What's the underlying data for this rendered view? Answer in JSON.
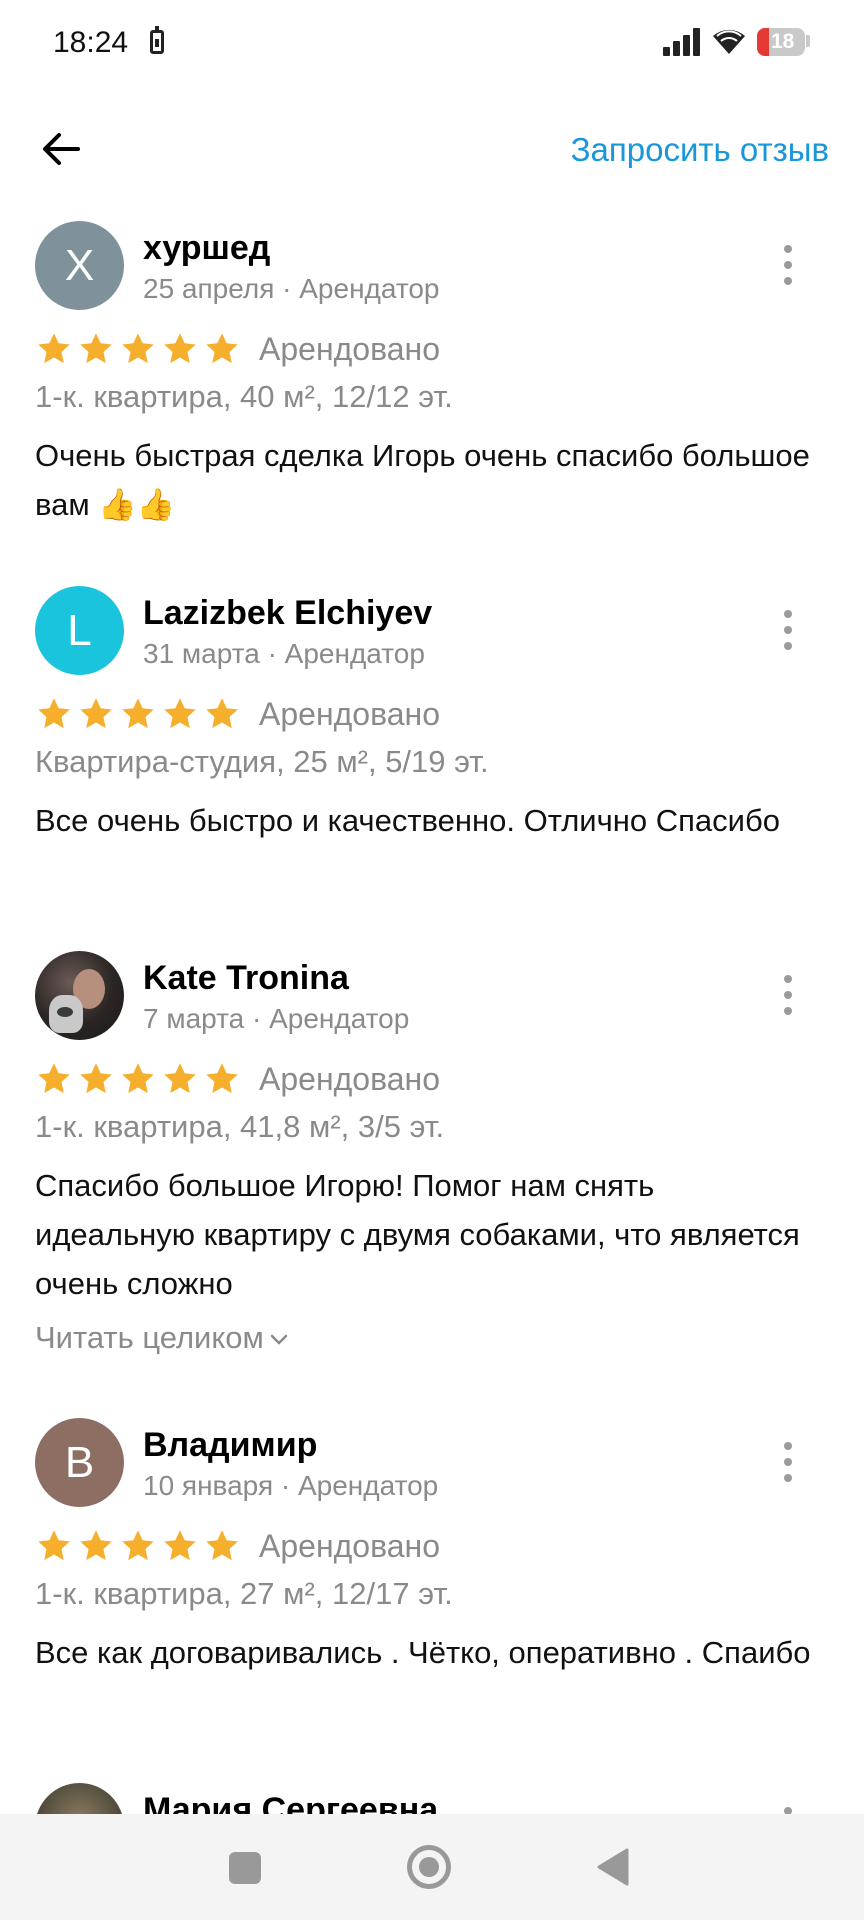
{
  "status_bar": {
    "time": "18:24",
    "battery_level": "18",
    "battery_low_color": "#e53935",
    "icons": [
      "battery-charging-icon",
      "signal-icon",
      "wifi-icon",
      "battery-icon"
    ]
  },
  "header": {
    "back_icon": "arrow-left-icon",
    "request_review_label": "Запросить отзыв",
    "accent_color": "#1a97d8"
  },
  "colors": {
    "star": "#f6ae2d",
    "muted_text": "#8a8a8a"
  },
  "reviews": [
    {
      "avatar_letter": "Х",
      "avatar_color": "#7f929c",
      "name": "хуршед",
      "meta": "25 апреля · Арендатор",
      "rating": 5,
      "status": "Арендовано",
      "property": "1-к. квартира, 40 м², 12/12 эт.",
      "text": "Очень быстрая сделка Игорь очень спасибо большое вам 👍👍"
    },
    {
      "avatar_letter": "L",
      "avatar_color": "#1bc4dd",
      "name": "Lazizbek Elchiyev",
      "meta": "31 марта · Арендатор",
      "rating": 5,
      "status": "Арендовано",
      "property": "Квартира-студия, 25 м², 5/19 эт.",
      "text": "Все очень быстро и качественно. Отлично Спасибо"
    },
    {
      "avatar_letter": "",
      "avatar_color": "#2a2523",
      "name": "Kate Tronina",
      "meta": "7 марта · Арендатор",
      "rating": 5,
      "status": "Арендовано",
      "property": "1-к. квартира, 41,8 м², 3/5 эт.",
      "text": "Спасибо большое Игорю! Помог нам снять идеальную квартиру с двумя собаками, что является очень сложно",
      "read_more": "Читать целиком"
    },
    {
      "avatar_letter": "В",
      "avatar_color": "#8d6e63",
      "name": "Владимир",
      "meta": "10 января · Арендатор",
      "rating": 5,
      "status": "Арендовано",
      "property": "1-к. квартира, 27 м², 12/17 эт.",
      "text": "Все как договаривались . Чётко,  оперативно . Спаибо"
    },
    {
      "name": "Мария Сергеевна"
    }
  ],
  "nav_bar": {
    "icons": [
      "recent-apps-icon",
      "home-icon",
      "back-triangle-icon"
    ]
  }
}
